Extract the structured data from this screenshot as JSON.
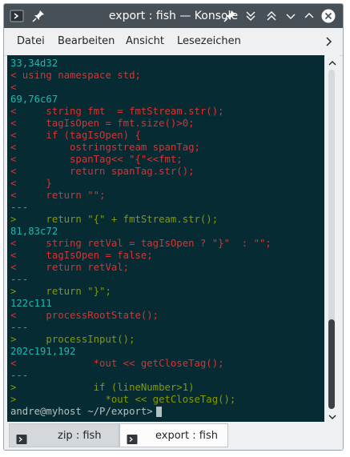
{
  "window": {
    "title": "export : fish — Konsole"
  },
  "titlebar_icons": [
    "terminal-icon",
    "pin-icon",
    "keep-below-icon",
    "keep-above-icon",
    "minimize-icon",
    "maximize-icon",
    "close-icon"
  ],
  "menubar": {
    "items": [
      "Datei",
      "Bearbeiten",
      "Ansicht",
      "Lesezeichen"
    ],
    "more_icon": "chevron-right-icon"
  },
  "terminal": {
    "lines": [
      {
        "text": "33,34d32",
        "color": "cyan"
      },
      {
        "text": "< using namespace std;",
        "color": "red"
      },
      {
        "text": "<",
        "color": "red"
      },
      {
        "text": "69,76c67",
        "color": "cyan"
      },
      {
        "text": "<     string fmt  = fmtStream.str();",
        "color": "red"
      },
      {
        "text": "<     tagIsOpen = fmt.size()>0;",
        "color": "red"
      },
      {
        "text": "<     if (tagIsOpen) {",
        "color": "red"
      },
      {
        "text": "<         ostringstream spanTag;",
        "color": "red"
      },
      {
        "text": "<         spanTag<< \"{\"<<fmt;",
        "color": "red"
      },
      {
        "text": "<         return spanTag.str();",
        "color": "red"
      },
      {
        "text": "<     }",
        "color": "red"
      },
      {
        "text": "<     return \"\";",
        "color": "red"
      },
      {
        "text": "---",
        "color": "gray"
      },
      {
        "text": ">     return \"{\" + fmtStream.str();",
        "color": "green"
      },
      {
        "text": "81,83c72",
        "color": "cyan"
      },
      {
        "text": "<     string retVal = tagIsOpen ? \"}\"  : \"\";",
        "color": "red"
      },
      {
        "text": "<     tagIsOpen = false;",
        "color": "red"
      },
      {
        "text": "<     return retVal;",
        "color": "red"
      },
      {
        "text": "---",
        "color": "gray"
      },
      {
        "text": ">     return \"}\";",
        "color": "green"
      },
      {
        "text": "122c111",
        "color": "cyan"
      },
      {
        "text": "<     processRootState();",
        "color": "red"
      },
      {
        "text": "---",
        "color": "gray"
      },
      {
        "text": ">     processInput();",
        "color": "green"
      },
      {
        "text": "202c191,192",
        "color": "cyan"
      },
      {
        "text": "<             *out << getCloseTag();",
        "color": "red"
      },
      {
        "text": "---",
        "color": "gray"
      },
      {
        "text": ">             if (lineNumber>1)",
        "color": "green"
      },
      {
        "text": ">               *out << getCloseTag();",
        "color": "green"
      }
    ],
    "prompt": "andre@myhost ~/P/export>"
  },
  "colors": {
    "terminal_bg": "#072b33",
    "cyan": "#22b5b0",
    "red": "#dc322f",
    "green": "#859900",
    "gray": "#7a8b8d"
  },
  "tabs": [
    {
      "label": "zip : fish",
      "active": true
    },
    {
      "label": "export : fish",
      "active": false
    }
  ]
}
